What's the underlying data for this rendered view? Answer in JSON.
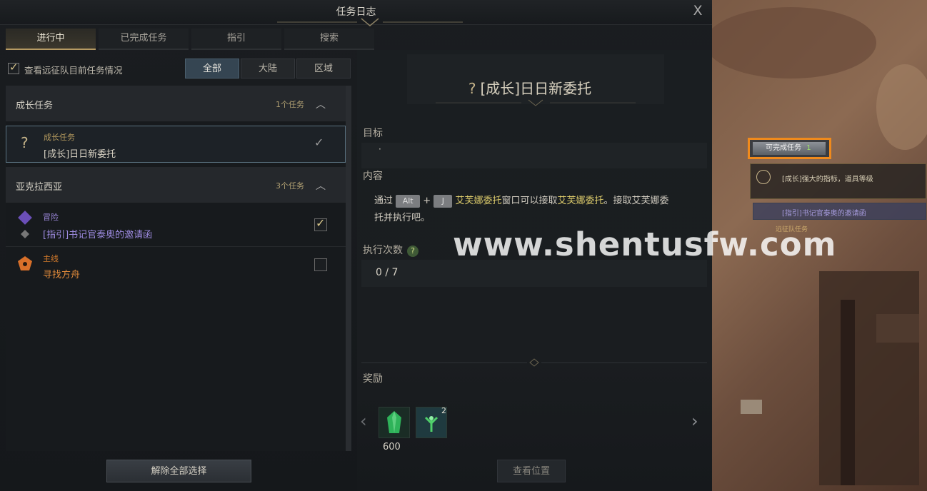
{
  "window": {
    "title": "任务日志",
    "close_label": "X"
  },
  "tabs": [
    {
      "label": "进行中",
      "active": true
    },
    {
      "label": "已完成任务",
      "active": false
    },
    {
      "label": "指引",
      "active": false
    },
    {
      "label": "搜索",
      "active": false
    }
  ],
  "filter": {
    "checkbox_label": "查看远征队目前任务情况",
    "checked": true,
    "segments": [
      "全部",
      "大陆",
      "区域"
    ],
    "active_segment": "全部"
  },
  "groups": [
    {
      "title": "成长任务",
      "count": "1个任务",
      "items": [
        {
          "category": "成长任务",
          "name": "[成长]日日新委托",
          "icon": "question-mark-icon",
          "selected": true
        }
      ]
    },
    {
      "title": "亚克拉西亚",
      "count": "3个任务",
      "items": [
        {
          "category": "冒险",
          "name": "[指引]书记官泰奥的邀请函",
          "icon": "adventure-diamond-icon",
          "checked": true
        },
        {
          "category": "主线",
          "name": "寻找方舟",
          "icon": "main-quest-icon",
          "checked": false
        }
      ]
    }
  ],
  "clear_button": "解除全部选择",
  "detail": {
    "title_mark": "?",
    "title": "[成长]日日新委托",
    "goal_label": "目标",
    "goal_value": "·",
    "content_label": "内容",
    "content": {
      "prefix": "通过",
      "key1": "Alt",
      "plus": "+",
      "key2": "J",
      "hl1": "艾芙娜委托",
      "mid": "窗口可以接取",
      "hl2": "艾芙娜委托",
      "suffix": "。接取艾芙娜委托并执行吧。"
    },
    "exec_label": "执行次数",
    "exec_help": "?",
    "exec_value": "0 / 7",
    "reward_label": "奖励",
    "rewards": [
      {
        "icon": "green-crystal-icon",
        "amount": "600"
      },
      {
        "icon": "green-plant-icon",
        "badge": "2"
      }
    ],
    "view_button": "查看位置"
  },
  "game": {
    "available_label": "可完成任务",
    "available_count": "1",
    "tracker1": "[成长]强大的指标，道具等级",
    "tracker2": "[指引]书记官泰奥的邀请函",
    "tracker3": "远征队任务"
  },
  "watermark": "www.shentusfw.com"
}
